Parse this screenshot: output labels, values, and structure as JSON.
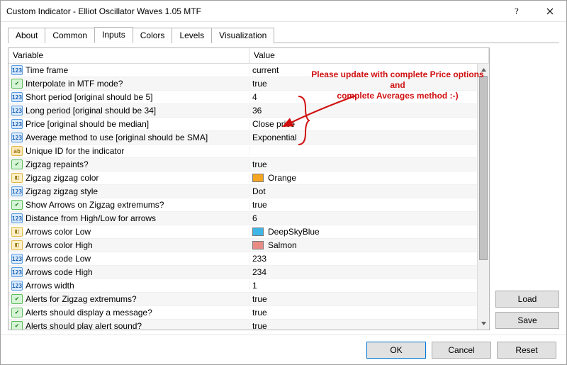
{
  "window": {
    "title": "Custom Indicator - Elliot Oscillator Waves 1.05 MTF"
  },
  "tabs": [
    {
      "label": "About",
      "active": false
    },
    {
      "label": "Common",
      "active": false
    },
    {
      "label": "Inputs",
      "active": true
    },
    {
      "label": "Colors",
      "active": false
    },
    {
      "label": "Levels",
      "active": false
    },
    {
      "label": "Visualization",
      "active": false
    }
  ],
  "columns": {
    "variable": "Variable",
    "value": "Value"
  },
  "icon_glyphs": {
    "int": "123",
    "bool": "✔",
    "color": "◧",
    "str": "ab"
  },
  "rows": [
    {
      "icon": "int",
      "name": "Time frame",
      "value": "current"
    },
    {
      "icon": "bool",
      "name": "Interpolate in MTF mode?",
      "value": "true"
    },
    {
      "icon": "int",
      "name": "Short period [original should be 5]",
      "value": "4"
    },
    {
      "icon": "int",
      "name": "Long period [original should be 34]",
      "value": "36"
    },
    {
      "icon": "int",
      "name": "Price [original should be median]",
      "value": "Close price"
    },
    {
      "icon": "int",
      "name": "Average method to use [original should be SMA]",
      "value": "Exponential"
    },
    {
      "icon": "str",
      "name": "Unique ID for the indicator",
      "value": ""
    },
    {
      "icon": "bool",
      "name": "Zigzag repaints?",
      "value": "true"
    },
    {
      "icon": "color",
      "name": "Zigzag zigzag color",
      "value": "Orange",
      "swatch": "#f5a623"
    },
    {
      "icon": "int",
      "name": "Zigzag zigzag style",
      "value": "Dot"
    },
    {
      "icon": "bool",
      "name": "Show Arrows on Zigzag extremums?",
      "value": "true"
    },
    {
      "icon": "int",
      "name": "Distance from High/Low for arrows",
      "value": "6"
    },
    {
      "icon": "color",
      "name": "Arrows color Low",
      "value": "DeepSkyBlue",
      "swatch": "#3fb7e6"
    },
    {
      "icon": "color",
      "name": "Arrows color High",
      "value": "Salmon",
      "swatch": "#e98b85"
    },
    {
      "icon": "int",
      "name": "Arrows code Low",
      "value": "233"
    },
    {
      "icon": "int",
      "name": "Arrows code High",
      "value": "234"
    },
    {
      "icon": "int",
      "name": "Arrows width",
      "value": "1"
    },
    {
      "icon": "bool",
      "name": "Alerts for Zigzag extremums?",
      "value": "true"
    },
    {
      "icon": "bool",
      "name": "Alerts should display a message?",
      "value": "true"
    },
    {
      "icon": "bool",
      "name": "Alerts should play alert sound?",
      "value": "true"
    }
  ],
  "annotation": {
    "line1": "Please update with complete Price options and",
    "line2": "complete Averages method :-)"
  },
  "side_buttons": {
    "load": "Load",
    "save": "Save"
  },
  "footer_buttons": {
    "ok": "OK",
    "cancel": "Cancel",
    "reset": "Reset"
  }
}
